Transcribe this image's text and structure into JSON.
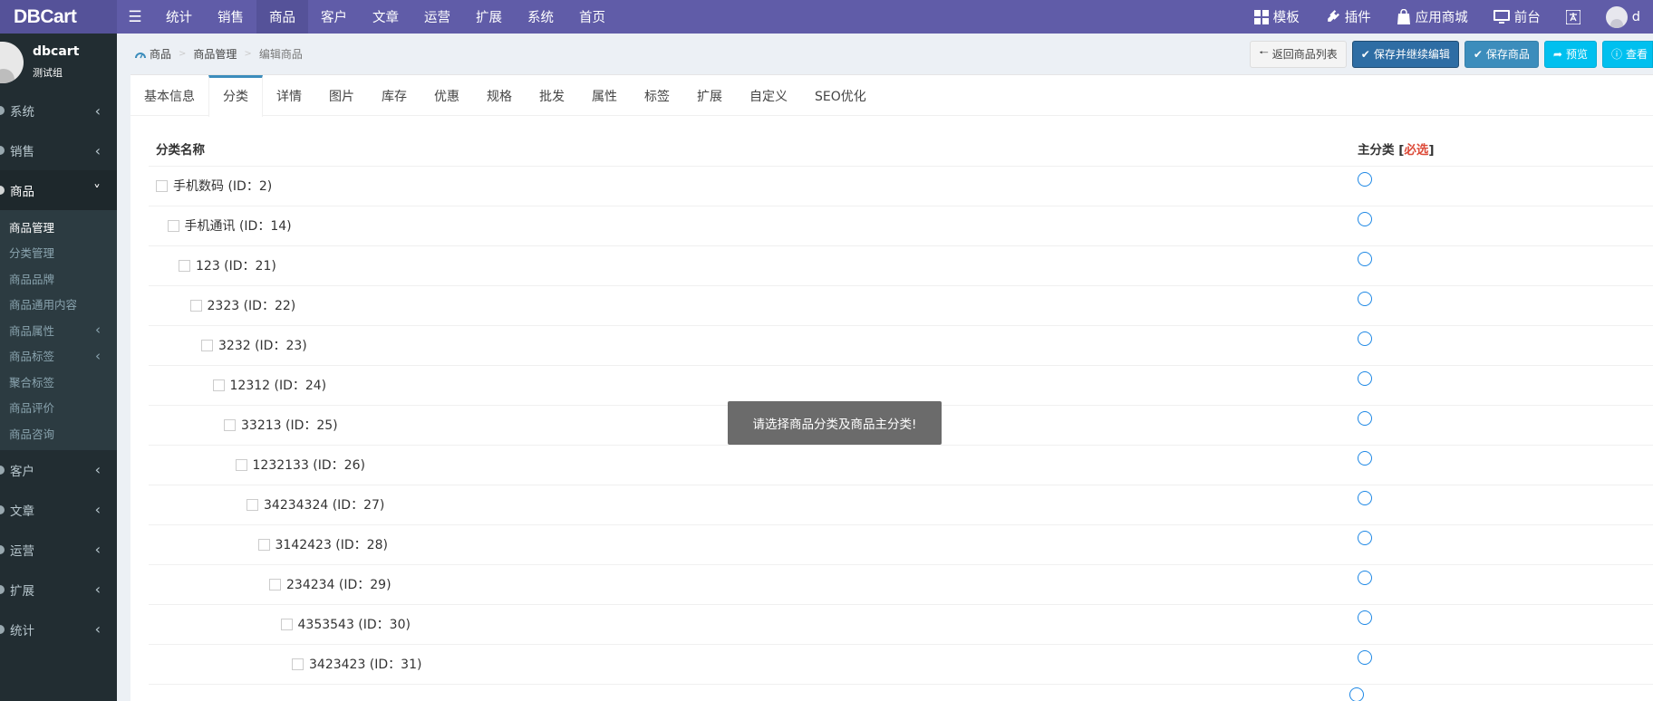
{
  "brand": "DBCart",
  "topnav": [
    "统计",
    "销售",
    "商品",
    "客户",
    "文章",
    "运营",
    "扩展",
    "系统",
    "首页"
  ],
  "topnav_active": "商品",
  "topright": {
    "template": "模板",
    "plugin": "插件",
    "appstore": "应用商城",
    "frontend": "前台",
    "user_initial": "d"
  },
  "sidebar": {
    "user_name": "dbcart",
    "user_group": "测试组",
    "menu": [
      {
        "label": "系统"
      },
      {
        "label": "销售"
      },
      {
        "label": "商品"
      },
      {
        "label": "客户"
      },
      {
        "label": "文章"
      },
      {
        "label": "运营"
      },
      {
        "label": "扩展"
      },
      {
        "label": "统计"
      }
    ],
    "submenu": [
      "商品管理",
      "分类管理",
      "商品品牌",
      "商品通用内容",
      "商品属性",
      "商品标签",
      "聚合标签",
      "商品评价",
      "商品咨询"
    ]
  },
  "breadcrumb": {
    "root": "商品",
    "section": "商品管理",
    "current": "编辑商品"
  },
  "actions": {
    "back": "返回商品列表",
    "save_continue": "保存并继续编辑",
    "save": "保存商品",
    "preview": "预览",
    "view": "查看"
  },
  "tabs": [
    "基本信息",
    "分类",
    "详情",
    "图片",
    "库存",
    "优惠",
    "规格",
    "批发",
    "属性",
    "标签",
    "扩展",
    "自定义",
    "SEO优化"
  ],
  "active_tab": "分类",
  "table": {
    "col_name": "分类名称",
    "col_main": "主分类",
    "col_main_required": "必选",
    "rows": [
      "手机数码 (ID：2)",
      "手机通讯 (ID：14)",
      "123 (ID：21)",
      "2323 (ID：22)",
      "3232 (ID：23)",
      "12312 (ID：24)",
      "33213 (ID：25)",
      "1232133 (ID：26)",
      "34234324 (ID：27)",
      "3142423 (ID：28)",
      "234234 (ID：29)",
      "4353543 (ID：30)",
      "3423423 (ID：31)"
    ]
  },
  "toast": "请选择商品分类及商品主分类!",
  "colors": {
    "topbar": "#605ca8",
    "sidebar": "#222d32",
    "accent": "#3c8dbc",
    "required": "#dd4b39"
  }
}
